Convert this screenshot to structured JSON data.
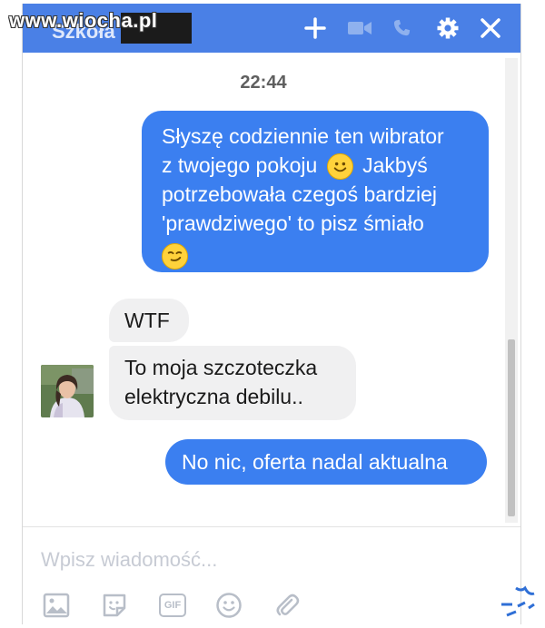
{
  "header": {
    "contact_name": "Szkoła",
    "watermark": "www.wiocha.pl",
    "icons": [
      "plus-icon",
      "video-camera-icon",
      "phone-icon",
      "gear-icon",
      "close-icon"
    ],
    "accent_color": "#4a80e6"
  },
  "thread": {
    "timestamp": "22:44",
    "messages": [
      {
        "direction": "outgoing",
        "lines": [
          "Słyszę codziennie ten wibrator",
          "z twojego pokoju",
          "Jakbyś",
          "potrzebowała czegoś bardziej",
          "'prawdziwego' to pisz śmiało"
        ],
        "emojis": [
          "smiling-face-icon",
          "smirking-face-icon"
        ]
      },
      {
        "direction": "incoming",
        "text": "WTF"
      },
      {
        "direction": "incoming",
        "lines": [
          "To moja szczoteczka",
          "elektryczna debilu.."
        ]
      },
      {
        "direction": "outgoing",
        "text": "No nic, oferta nadal aktualna"
      }
    ],
    "outgoing_color": "#3b7ff0",
    "incoming_color": "#f0f0f1"
  },
  "composer": {
    "placeholder": "Wpisz wiadomość...",
    "tools": [
      "photo-icon",
      "sticker-icon",
      "gif-icon",
      "emoji-icon",
      "attachment-icon"
    ],
    "gif_label": "GIF"
  }
}
